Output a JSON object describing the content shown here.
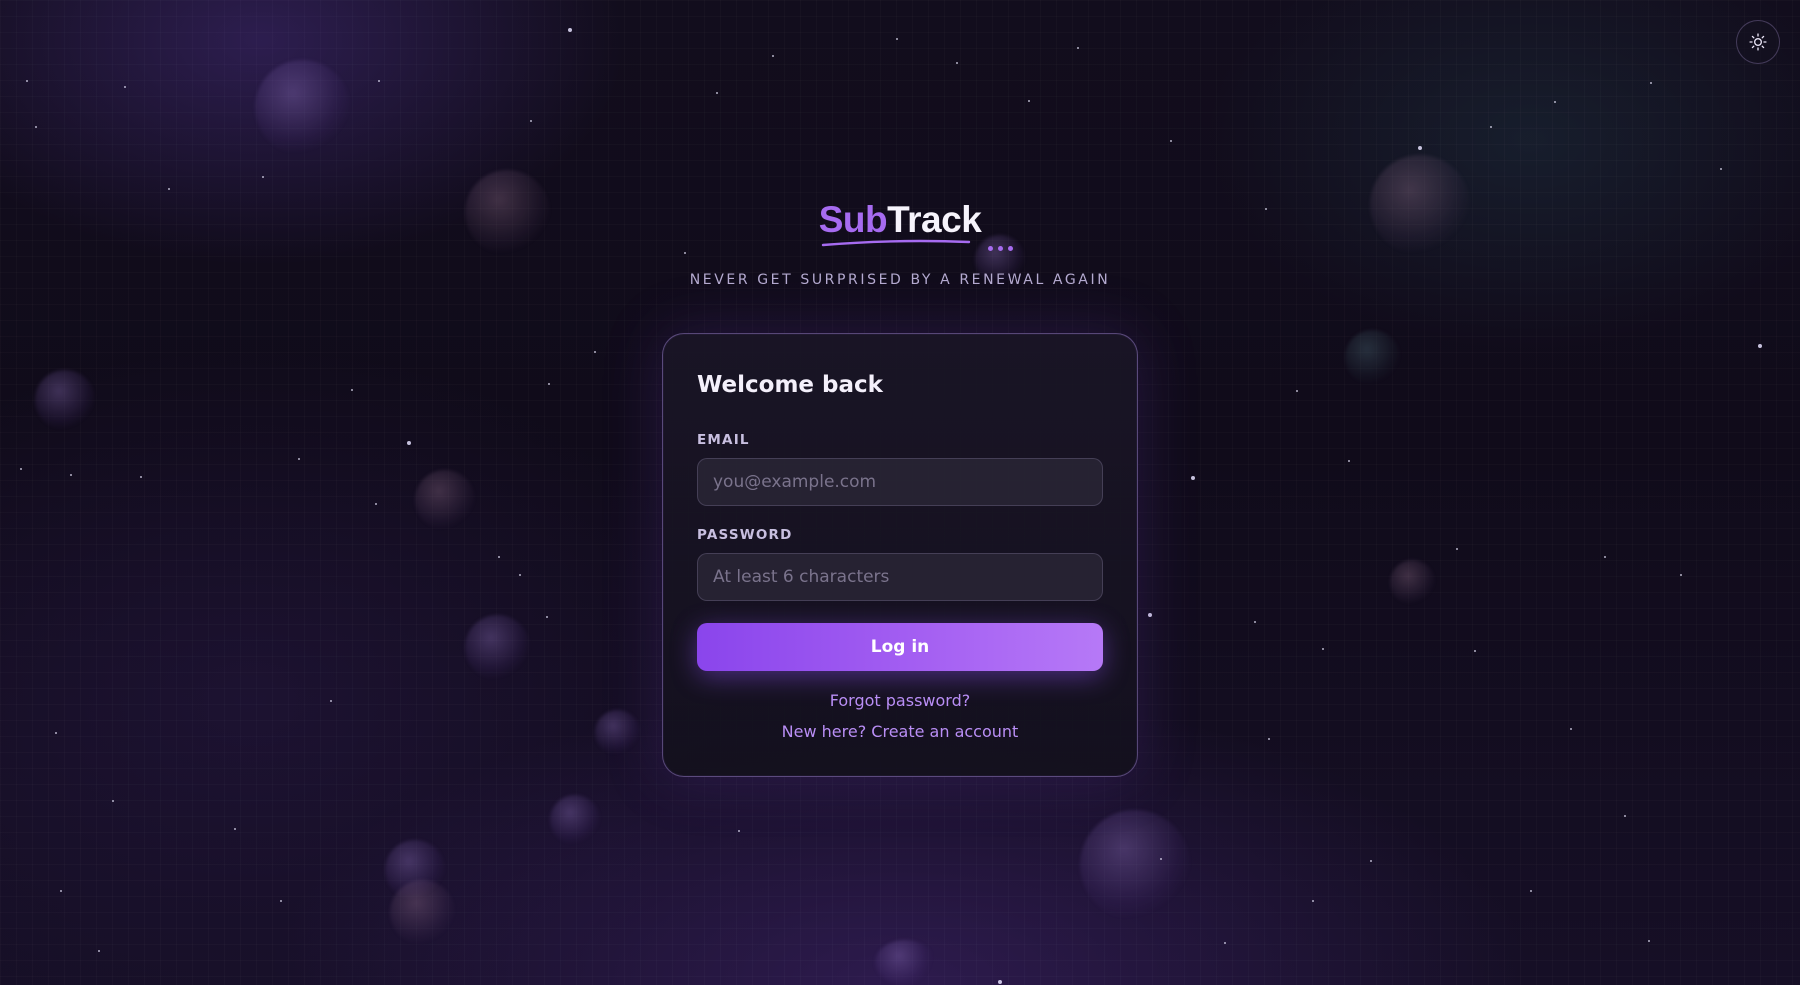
{
  "theme_toggle": {
    "icon": "sun-icon"
  },
  "brand": {
    "logo_first": "Sub",
    "logo_second": "Track",
    "tagline": "NEVER GET SURPRISED BY A RENEWAL AGAIN",
    "accent_color": "#a66bf0"
  },
  "login_card": {
    "title": "Welcome back",
    "email": {
      "label": "EMAIL",
      "placeholder": "you@example.com",
      "value": ""
    },
    "password": {
      "label": "PASSWORD",
      "placeholder": "At least 6 characters",
      "value": ""
    },
    "submit_label": "Log in",
    "forgot_password_link": "Forgot password?",
    "create_account_link": "New here? Create an account"
  }
}
